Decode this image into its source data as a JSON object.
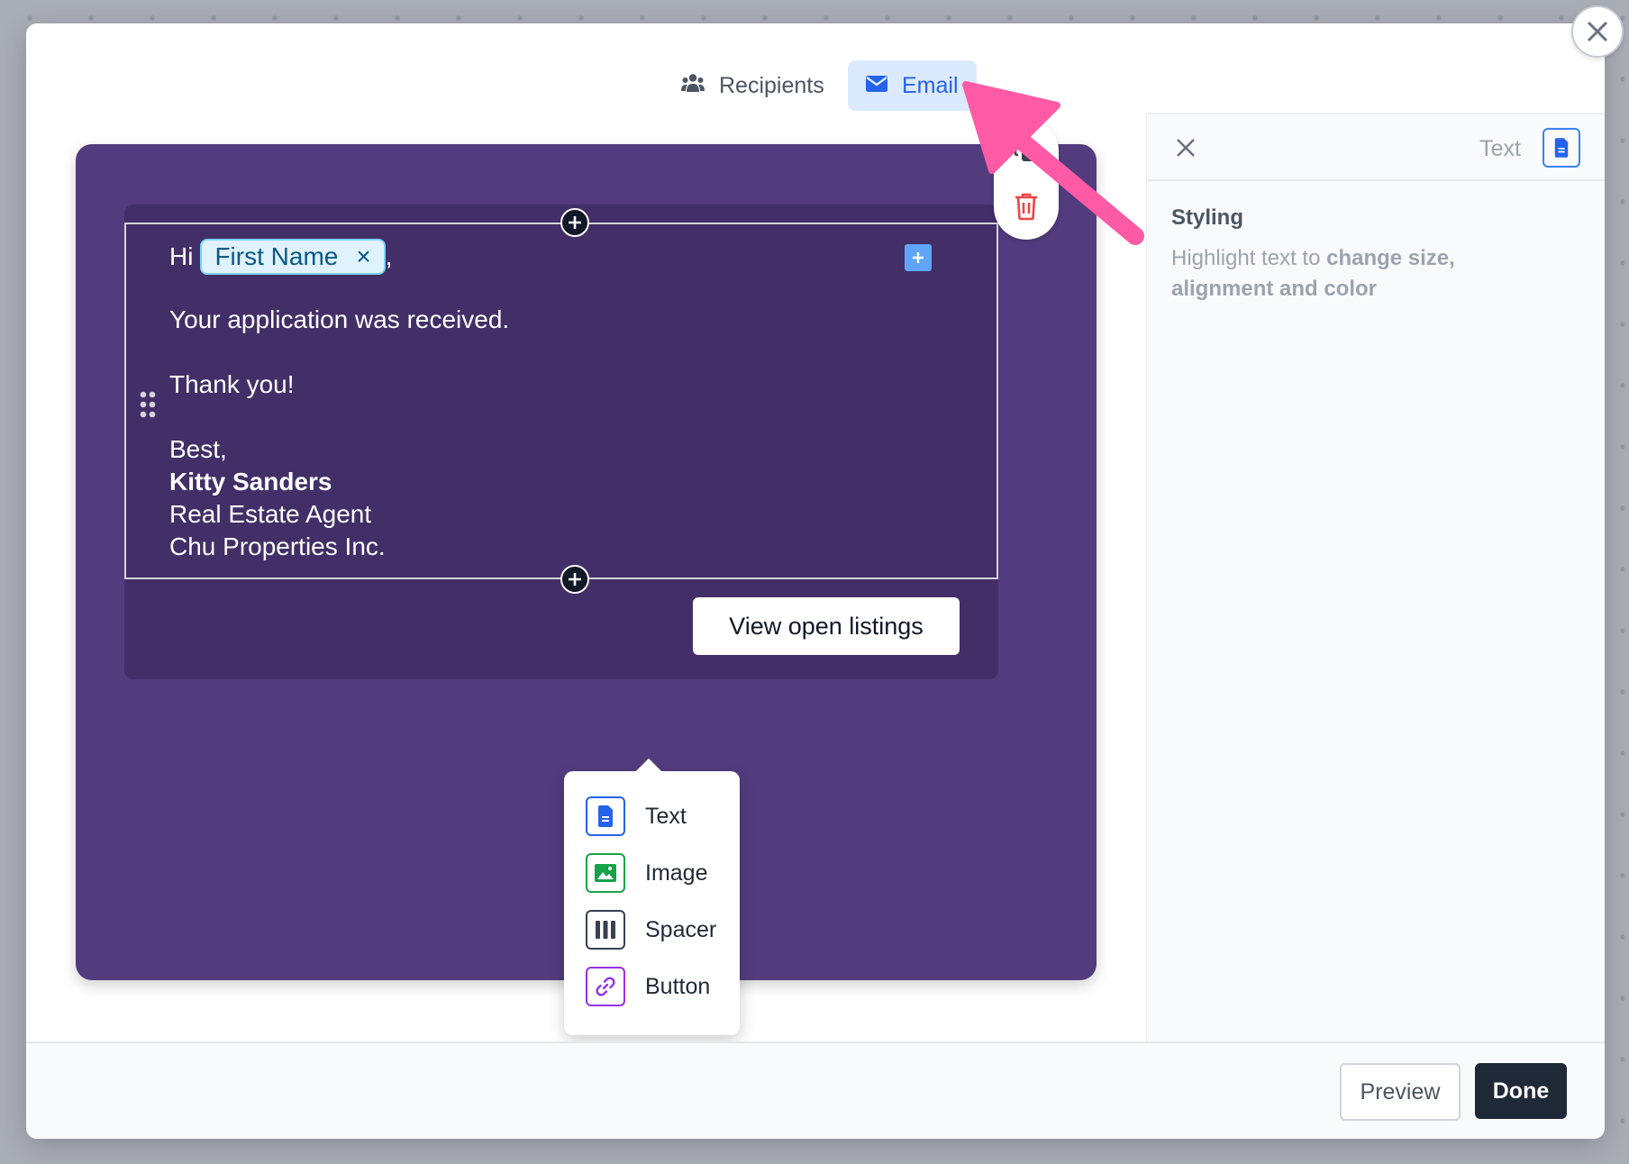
{
  "tabs": {
    "recipients_label": "Recipients",
    "email_label": "Email"
  },
  "email": {
    "greeting_hi": "Hi",
    "merge_tag": "First Name",
    "merge_tag_remove": "×",
    "greeting_comma": ",",
    "line1": "Your application was received.",
    "line2": "Thank you!",
    "signoff": "Best,",
    "sender_name": "Kitty Sanders",
    "sender_title": "Real Estate Agent",
    "sender_company": "Chu Properties Inc.",
    "button_label": "View open listings",
    "canvas_color": "#533c7e",
    "body_color": "#432f67"
  },
  "block_menu": {
    "items": [
      {
        "label": "Text",
        "icon": "document-icon",
        "color": "#2563eb"
      },
      {
        "label": "Image",
        "icon": "image-icon",
        "color": "#16a34a"
      },
      {
        "label": "Spacer",
        "icon": "columns-icon",
        "color": "#374151"
      },
      {
        "label": "Button",
        "icon": "link-icon",
        "color": "#9333ea"
      }
    ]
  },
  "panel": {
    "type_label": "Text",
    "styling_title": "Styling",
    "hint_prefix": "Highlight text to ",
    "hint_bold": "change size, alignment and color"
  },
  "footer": {
    "preview_label": "Preview",
    "done_label": "Done"
  },
  "annotation": {
    "arrow_color": "#ff5aa5",
    "arrow_icon": "pointer-arrow"
  }
}
